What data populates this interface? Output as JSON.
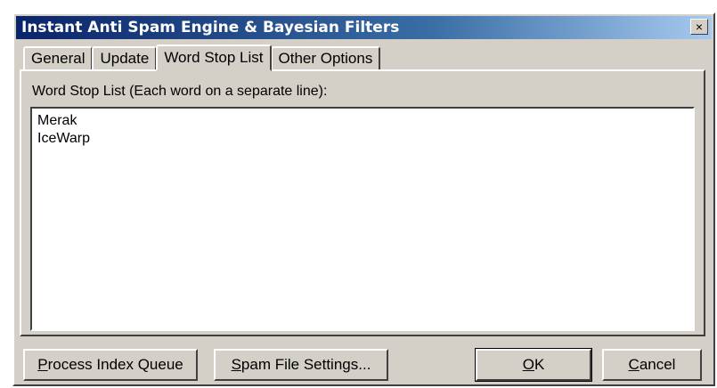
{
  "window": {
    "title": "Instant Anti Spam Engine & Bayesian Filters",
    "close_glyph": "×"
  },
  "tabs": [
    {
      "label": "General"
    },
    {
      "label": "Update"
    },
    {
      "label": "Word Stop List",
      "active": true
    },
    {
      "label": "Other Options"
    }
  ],
  "panel": {
    "label": "Word Stop List (Each word on a separate line):",
    "lines": [
      "Merak",
      "IceWarp"
    ]
  },
  "buttons": {
    "process_index_queue": {
      "accel": "P",
      "rest": "rocess Index Queue"
    },
    "spam_file_settings": {
      "accel": "S",
      "rest": "pam File Settings..."
    },
    "ok": {
      "accel": "O",
      "rest": "K"
    },
    "cancel": {
      "accel": "C",
      "rest": "ancel"
    }
  },
  "colors": {
    "face": "#d4d0c8",
    "title_start": "#0a246a",
    "title_end": "#a6caf0"
  }
}
